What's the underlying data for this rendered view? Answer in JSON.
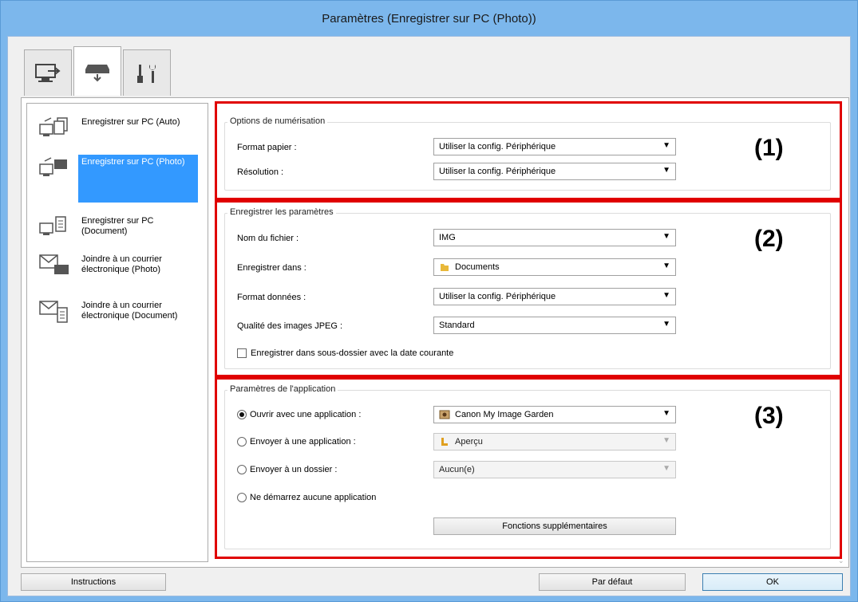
{
  "window": {
    "title": "Paramètres (Enregistrer sur PC (Photo))"
  },
  "tabs": [
    {
      "icon": "scan-from-computer-icon"
    },
    {
      "icon": "scan-from-operation-panel-icon"
    },
    {
      "icon": "general-settings-icon"
    }
  ],
  "sidebar": {
    "items": [
      {
        "label": "Enregistrer sur PC (Auto)",
        "icon": "save-pc-auto-icon"
      },
      {
        "label": "Enregistrer sur PC (Photo)",
        "icon": "save-pc-photo-icon",
        "selected": true
      },
      {
        "label": "Enregistrer sur PC (Document)",
        "icon": "save-pc-document-icon"
      },
      {
        "label": "Joindre à un courrier électronique (Photo)",
        "icon": "email-photo-icon"
      },
      {
        "label": "Joindre à un courrier électronique (Document)",
        "icon": "email-document-icon"
      }
    ]
  },
  "scan_options": {
    "group_label": "Options de numérisation",
    "paper_size_label": "Format papier :",
    "paper_size_value": "Utiliser la config. Périphérique",
    "resolution_label": "Résolution :",
    "resolution_value": "Utiliser la config. Périphérique",
    "marker": "(1)"
  },
  "save_settings": {
    "group_label": "Enregistrer les paramètres",
    "filename_label": "Nom du fichier :",
    "filename_value": "IMG",
    "save_in_label": "Enregistrer dans :",
    "save_in_value": "Documents",
    "data_format_label": "Format données :",
    "data_format_value": "Utiliser la config. Périphérique",
    "jpeg_quality_label": "Qualité des images JPEG :",
    "jpeg_quality_value": "Standard",
    "subfolder_label": "Enregistrer dans sous-dossier avec la date courante",
    "subfolder_checked": false,
    "marker": "(2)"
  },
  "app_settings": {
    "group_label": "Paramètres de l'application",
    "open_app_label": "Ouvrir avec une application :",
    "open_app_value": "Canon My Image Garden",
    "send_app_label": "Envoyer à une application :",
    "send_app_value": "Aperçu",
    "send_folder_label": "Envoyer à un dossier :",
    "send_folder_value": "Aucun(e)",
    "no_app_label": "Ne démarrez aucune application",
    "more_functions_label": "Fonctions supplémentaires",
    "selected": "open_app",
    "marker": "(3)"
  },
  "footer": {
    "instructions_label": "Instructions",
    "defaults_label": "Par défaut",
    "ok_label": "OK"
  },
  "colors": {
    "highlight": "#e00000",
    "selection": "#3399ff",
    "titlebar": "#7cb7ec"
  }
}
